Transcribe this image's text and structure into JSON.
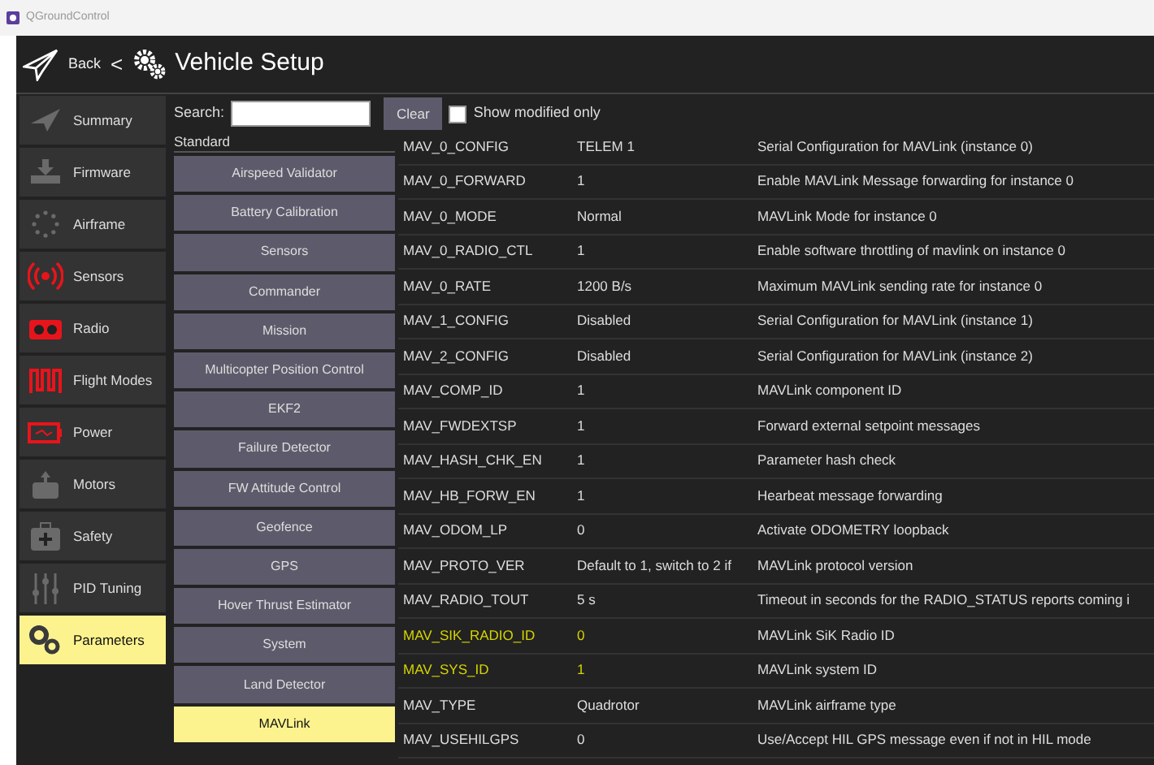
{
  "window": {
    "title": "QGroundControl"
  },
  "header": {
    "back": "Back",
    "separator": "<",
    "title": "Vehicle Setup"
  },
  "sidebar": {
    "items": [
      {
        "label": "Summary",
        "kind": "plane",
        "color": "#6a6a6a",
        "selected": false
      },
      {
        "label": "Firmware",
        "kind": "download",
        "color": "#6a6a6a",
        "selected": false
      },
      {
        "label": "Airframe",
        "kind": "dots",
        "color": "#6a6a6a",
        "selected": false
      },
      {
        "label": "Sensors",
        "kind": "signal",
        "color": "#e8141b",
        "selected": false
      },
      {
        "label": "Radio",
        "kind": "radio",
        "color": "#e8141b",
        "selected": false
      },
      {
        "label": "Flight Modes",
        "kind": "wave",
        "color": "#e8141b",
        "selected": false
      },
      {
        "label": "Power",
        "kind": "battery",
        "color": "#e8141b",
        "selected": false
      },
      {
        "label": "Motors",
        "kind": "motor",
        "color": "#6a6a6a",
        "selected": false
      },
      {
        "label": "Safety",
        "kind": "kit",
        "color": "#6a6a6a",
        "selected": false
      },
      {
        "label": "PID Tuning",
        "kind": "sliders",
        "color": "#6a6a6a",
        "selected": false
      },
      {
        "label": "Parameters",
        "kind": "gears",
        "color": "#3a3a3a",
        "selected": true
      }
    ]
  },
  "search": {
    "label": "Search:",
    "clear": "Clear",
    "show_modified": {
      "label": "Show modified only",
      "checked": false
    }
  },
  "groups": {
    "heading": "Standard",
    "items": [
      {
        "label": "Airspeed Validator",
        "selected": false
      },
      {
        "label": "Battery Calibration",
        "selected": false
      },
      {
        "label": "Sensors",
        "selected": false
      },
      {
        "label": "Commander",
        "selected": false
      },
      {
        "label": "Mission",
        "selected": false
      },
      {
        "label": "Multicopter Position Control",
        "selected": false
      },
      {
        "label": "EKF2",
        "selected": false
      },
      {
        "label": "Failure Detector",
        "selected": false
      },
      {
        "label": "FW Attitude Control",
        "selected": false
      },
      {
        "label": "Geofence",
        "selected": false
      },
      {
        "label": "GPS",
        "selected": false
      },
      {
        "label": "Hover Thrust Estimator",
        "selected": false
      },
      {
        "label": "System",
        "selected": false
      },
      {
        "label": "Land Detector",
        "selected": false
      },
      {
        "label": "MAVLink",
        "selected": true
      }
    ]
  },
  "table": {
    "rows": [
      {
        "name": "MAV_0_CONFIG",
        "value": "TELEM 1",
        "description": "Serial Configuration for MAVLink (instance 0)",
        "highlighted": false
      },
      {
        "name": "MAV_0_FORWARD",
        "value": "1",
        "description": "Enable MAVLink Message forwarding for instance 0",
        "highlighted": false
      },
      {
        "name": "MAV_0_MODE",
        "value": "Normal",
        "description": "MAVLink Mode for instance 0",
        "highlighted": false
      },
      {
        "name": "MAV_0_RADIO_CTL",
        "value": "1",
        "description": "Enable software throttling of mavlink on instance 0",
        "highlighted": false
      },
      {
        "name": "MAV_0_RATE",
        "value": "1200 B/s",
        "description": "Maximum MAVLink sending rate for instance 0",
        "highlighted": false
      },
      {
        "name": "MAV_1_CONFIG",
        "value": "Disabled",
        "description": "Serial Configuration for MAVLink (instance 1)",
        "highlighted": false
      },
      {
        "name": "MAV_2_CONFIG",
        "value": "Disabled",
        "description": "Serial Configuration for MAVLink (instance 2)",
        "highlighted": false
      },
      {
        "name": "MAV_COMP_ID",
        "value": "1",
        "description": "MAVLink component ID",
        "highlighted": false
      },
      {
        "name": "MAV_FWDEXTSP",
        "value": "1",
        "description": "Forward external setpoint messages",
        "highlighted": false
      },
      {
        "name": "MAV_HASH_CHK_EN",
        "value": "1",
        "description": "Parameter hash check",
        "highlighted": false
      },
      {
        "name": "MAV_HB_FORW_EN",
        "value": "1",
        "description": "Hearbeat message forwarding",
        "highlighted": false
      },
      {
        "name": "MAV_ODOM_LP",
        "value": "0",
        "description": "Activate ODOMETRY loopback",
        "highlighted": false
      },
      {
        "name": "MAV_PROTO_VER",
        "value": "Default to 1, switch to 2 if",
        "description": "MAVLink protocol version",
        "highlighted": false
      },
      {
        "name": "MAV_RADIO_TOUT",
        "value": "5 s",
        "description": "Timeout in seconds for the RADIO_STATUS reports coming i",
        "highlighted": false
      },
      {
        "name": "MAV_SIK_RADIO_ID",
        "value": "0",
        "description": "MAVLink SiK Radio ID",
        "highlighted": true
      },
      {
        "name": "MAV_SYS_ID",
        "value": "1",
        "description": "MAVLink system ID",
        "highlighted": true
      },
      {
        "name": "MAV_TYPE",
        "value": "Quadrotor",
        "description": "MAVLink airframe type",
        "highlighted": false
      },
      {
        "name": "MAV_USEHILGPS",
        "value": "0",
        "description": "Use/Accept HIL GPS message even if not in HIL mode",
        "highlighted": false
      }
    ]
  }
}
